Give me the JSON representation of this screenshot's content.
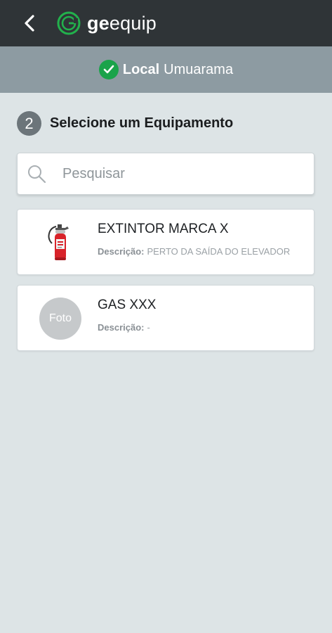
{
  "header": {
    "back_icon": "chevron-left-icon",
    "logo_icon": "geequip-logo-icon",
    "logo_bold": "ge",
    "logo_light": "equip",
    "bg_color": "#2f3437"
  },
  "location": {
    "icon": "check-circle-icon",
    "label": "Local",
    "value": "Umuarama",
    "bg_color": "#8d9ba2",
    "check_color": "#1aa34a"
  },
  "step": {
    "number": "2",
    "title": "Selecione um Equipamento"
  },
  "search": {
    "icon": "search-icon",
    "placeholder": "Pesquisar",
    "value": ""
  },
  "equipment": [
    {
      "name": "EXTINTOR MARCA X",
      "desc_label": "Descrição:",
      "desc_value": "PERTO DA SAÍDA DO ELEVADOR",
      "image": "fire-extinguisher-icon"
    },
    {
      "name": "GAS XXX",
      "desc_label": "Descrição:",
      "desc_value": "-",
      "photo_placeholder": "Foto"
    }
  ]
}
